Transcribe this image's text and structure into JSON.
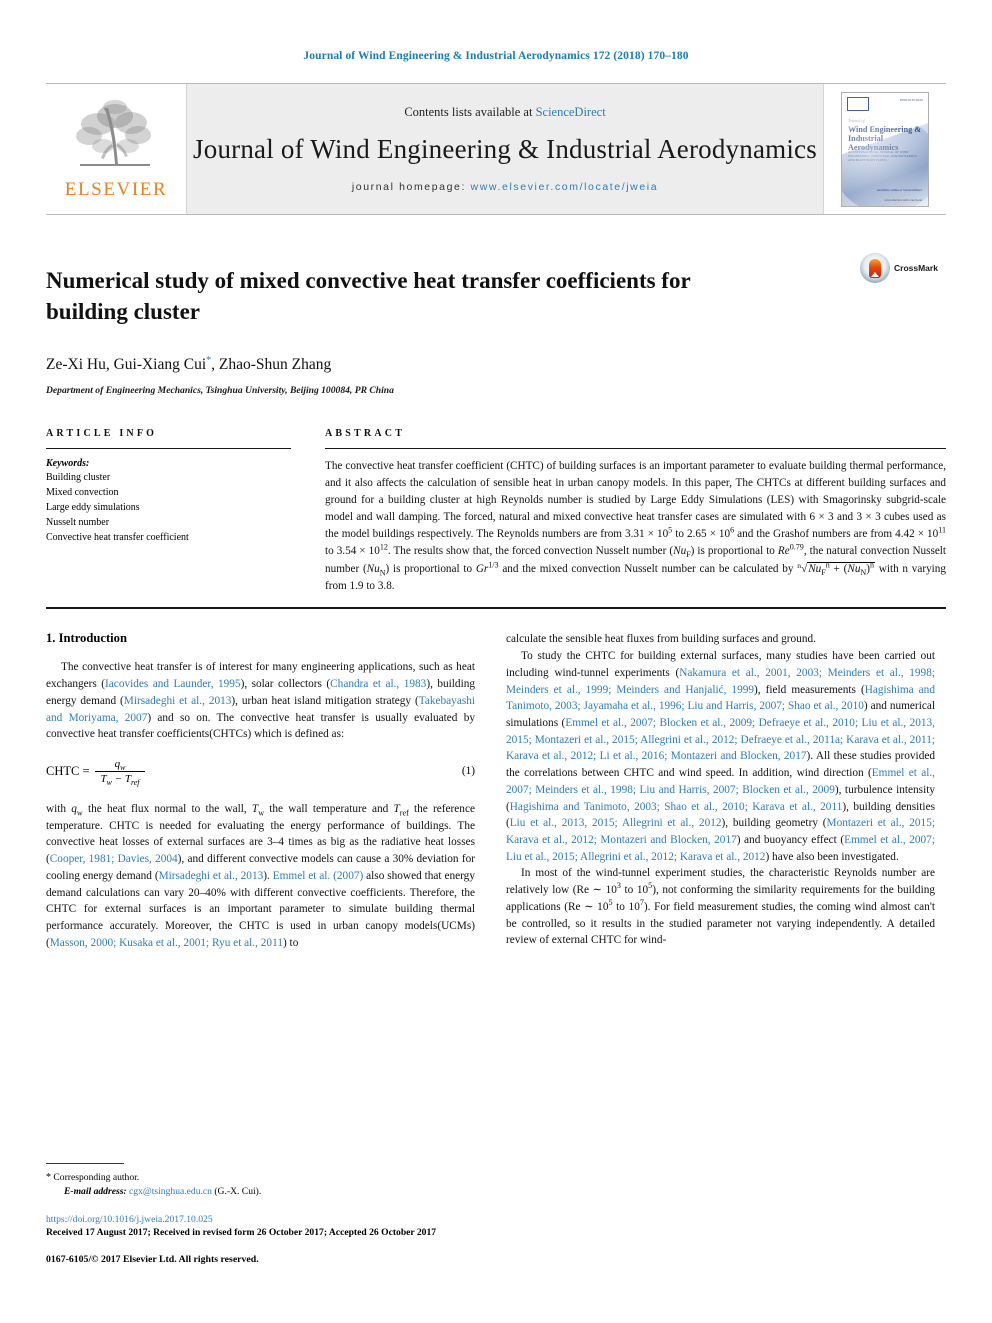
{
  "running_head": "Journal of Wind Engineering & Industrial Aerodynamics 172 (2018) 170–180",
  "masthead": {
    "contents_prefix": "Contents lists available at ",
    "sciencedirect": "ScienceDirect",
    "journal_title": "Journal of Wind Engineering & Industrial Aerodynamics",
    "homepage_label": "journal homepage:",
    "homepage_url": "www.elsevier.com/locate/jweia",
    "publisher": "ELSEVIER",
    "cover": {
      "issn": "ISSN 0167-6105",
      "superline": "Journal of",
      "title": "Wind Engineering & Industrial Aerodynamics",
      "subtitle": "AN INTERNATIONAL JOURNAL OF WIND ENGINEERING, INDUSTRIAL AERODYNAMICS AND BLUFF BODY FLOWS",
      "editors": "Editors: Ahsan Kareem, Yukio Tamura, Gregory A. Kopp",
      "foot": "Available online at ScienceDirect",
      "foot2": "www.elsevier.com/locate/jweia"
    }
  },
  "article": {
    "title": "Numerical study of mixed convective heat transfer coefficients for building cluster",
    "authors": "Ze-Xi Hu, Gui-Xiang Cui",
    "authors_tail": ", Zhao-Shun Zhang",
    "corresponding_marker": "*",
    "affiliation": "Department of Engineering Mechanics, Tsinghua University, Beijing 100084, PR China",
    "crossmark_label": "CrossMark"
  },
  "article_info": {
    "heading": "ARTICLE INFO",
    "keywords_label": "Keywords:",
    "keywords": [
      "Building cluster",
      "Mixed convection",
      "Large eddy simulations",
      "Nusselt number",
      "Convective heat transfer coefficient"
    ]
  },
  "abstract": {
    "heading": "ABSTRACT",
    "paragraph_1": "The convective heat transfer coefficient (CHTC) of building surfaces is an important parameter to evaluate building thermal performance, and it also affects the calculation of sensible heat in urban canopy models. In this paper, The CHTCs at different building surfaces and ground for a building cluster at high Reynolds number is studied by Large Eddy Simulations (LES) with Smagorinsky subgrid-scale model and wall damping. The forced, natural and mixed convective heat transfer cases are simulated with 6 × 3 and 3 × 3 cubes used as the model buildings respectively. The Reynolds numbers are from 3.31 × 10",
    "re_low_exp": "5",
    "frag_2": " to 2.65 × 10",
    "re_high_exp": "6",
    "frag_3": " and the Grashof numbers are from 4.42 × 10",
    "gr_low_exp": "11",
    "frag_4": " to 3.54 × 10",
    "gr_high_exp": "12",
    "frag_5": ". The results show that, the forced convection Nusselt number (",
    "nu_f": "Nu",
    "nu_f_sub": "F",
    "frag_6": ") is proportional to ",
    "re_sym": "Re",
    "re_exp": "0.79",
    "frag_7": ", the natural convection Nusselt number (",
    "nu_n": "Nu",
    "nu_n_sub": "N",
    "frag_8": ") is proportional to ",
    "gr_sym": "Gr",
    "gr_exp": "1/3",
    "frag_9": " and the mixed convection Nusselt number can be calculated by ",
    "formula_root": "ⁿ√",
    "formula_body": "(Nu",
    "formula_tail": " with n varying from 1.9 to 3.8."
  },
  "introduction": {
    "number_title": "1.  Introduction",
    "left_p1_a": "The convective heat transfer is of interest for many engineering applications, such as heat exchangers (",
    "left_cite_1": "Iacovides and Launder, 1995",
    "left_p1_b": "), solar collectors (",
    "left_cite_2": "Chandra et al., 1983",
    "left_p1_c": "), building energy demand (",
    "left_cite_3": "Mirsadeghi et al., 2013",
    "left_p1_d": "), urban heat island mitigation strategy (",
    "left_cite_4": "Takebayashi and Moriyama, 2007",
    "left_p1_e": ") and so on. The convective heat transfer is usually evaluated by convective heat transfer coefficients(CHTCs) which is defined as:",
    "equation": {
      "lhs": "CHTC =",
      "numerator": "q",
      "numerator_sub": "w",
      "denominator_a": "T",
      "denominator_a_sub": "w",
      "denominator_minus": " − ",
      "denominator_b": "T",
      "denominator_b_sub": "ref",
      "number": "(1)"
    },
    "left_p2_a": "with ",
    "left_p2_qw": "q",
    "left_p2_qw_sub": "w",
    "left_p2_b": " the heat flux normal to the wall, ",
    "left_p2_tw": "T",
    "left_p2_tw_sub": "w",
    "left_p2_c": " the wall temperature and ",
    "left_p2_tref": "T",
    "left_p2_tref_sub": "ref",
    "left_p2_d": " the reference temperature. CHTC is needed for evaluating the energy performance of buildings. The convective heat losses of external surfaces are 3–4 times as big as the radiative heat losses (",
    "left_cite_5": "Cooper, 1981; Davies, 2004",
    "left_p2_e": "), and different convective models can cause a 30% deviation for cooling energy demand (",
    "left_cite_6": "Mirsadeghi et al., 2013",
    "left_p2_f": "). ",
    "left_cite_7": "Emmel et al. (2007)",
    "left_p2_g": " also showed that energy demand calculations can vary 20–40% with different convective coefficients. Therefore, the CHTC for external surfaces is an important parameter to simulate building thermal performance accurately. Moreover, the CHTC is used in urban canopy models(UCMs) (",
    "left_cite_8": "Masson, 2000; Kusaka et al., 2001; Ryu et al., 2011",
    "left_p2_h": ") to",
    "right_p1": "calculate the sensible heat fluxes from building surfaces and ground.",
    "right_p2_a": "To study the CHTC for building external surfaces, many studies have been carried out including wind-tunnel experiments (",
    "right_cite_1": "Nakamura et al., 2001, 2003; Meinders et al., 1998; Meinders et al., 1999; Meinders and Hanjalić, 1999",
    "right_p2_b": "), field measurements (",
    "right_cite_2": "Hagishima and Tanimoto, 2003; Jayamaha et al., 1996; Liu and Harris, 2007; Shao et al., 2010",
    "right_p2_c": ") and numerical simulations (",
    "right_cite_3": "Emmel et al., 2007; Blocken et al., 2009; Defraeye et al., 2010; Liu et al., 2013, 2015; Montazeri et al., 2015; Allegrini et al., 2012; Defraeye et al., 2011a; Karava et al., 2011; Karava et al., 2012; Li et al., 2016; Montazeri and Blocken, 2017",
    "right_p2_d": "). All these studies provided the correlations between CHTC and wind speed. In addition, wind direction (",
    "right_cite_4": "Emmel et al., 2007; Meinders et al., 1998; Liu and Harris, 2007; Blocken et al., 2009",
    "right_p2_e": "), turbulence intensity (",
    "right_cite_5": "Hagishima and Tanimoto, 2003; Shao et al., 2010; Karava et al., 2011",
    "right_p2_f": "), building densities (",
    "right_cite_6": "Liu et al., 2013, 2015; Allegrini et al., 2012",
    "right_p2_g": "), building geometry (",
    "right_cite_7": "Montazeri et al., 2015; Karava et al., 2012; Montazeri and Blocken, 2017",
    "right_p2_h": ") and buoyancy effect (",
    "right_cite_8": "Emmel et al., 2007; Liu et al., 2015; Allegrini et al., 2012; Karava et al., 2012",
    "right_p2_i": ") have also been investigated.",
    "right_p3_a": "In most of the wind-tunnel experiment studies, the characteristic Reynolds number are relatively low (Re ∼ 10",
    "right_p3_e1": "3",
    "right_p3_b": " to 10",
    "right_p3_e2": "5",
    "right_p3_c": "), not conforming the similarity requirements for the building applications (Re ∼ 10",
    "right_p3_e3": "5",
    "right_p3_d": " to 10",
    "right_p3_e4": "7",
    "right_p3_f": "). For field measurement studies, the coming wind almost can't be controlled, so it results in the studied parameter not varying independently. A detailed review of external CHTC for wind-"
  },
  "footer": {
    "corresponding_star": "*",
    "corresponding_text": "Corresponding author.",
    "email_label": "E-mail address:",
    "email": "cgx@tsinghua.edu.cn",
    "email_owner": "(G.-X. Cui).",
    "doi": "https://doi.org/10.1016/j.jweia.2017.10.025",
    "history": "Received 17 August 2017; Received in revised form 26 October 2017; Accepted 26 October 2017",
    "copyright": "0167-6105/© 2017 Elsevier Ltd. All rights reserved."
  },
  "colors": {
    "link": "#2f7db5",
    "elsevier_orange": "#e8821e",
    "masthead_bg": "#ededed"
  }
}
